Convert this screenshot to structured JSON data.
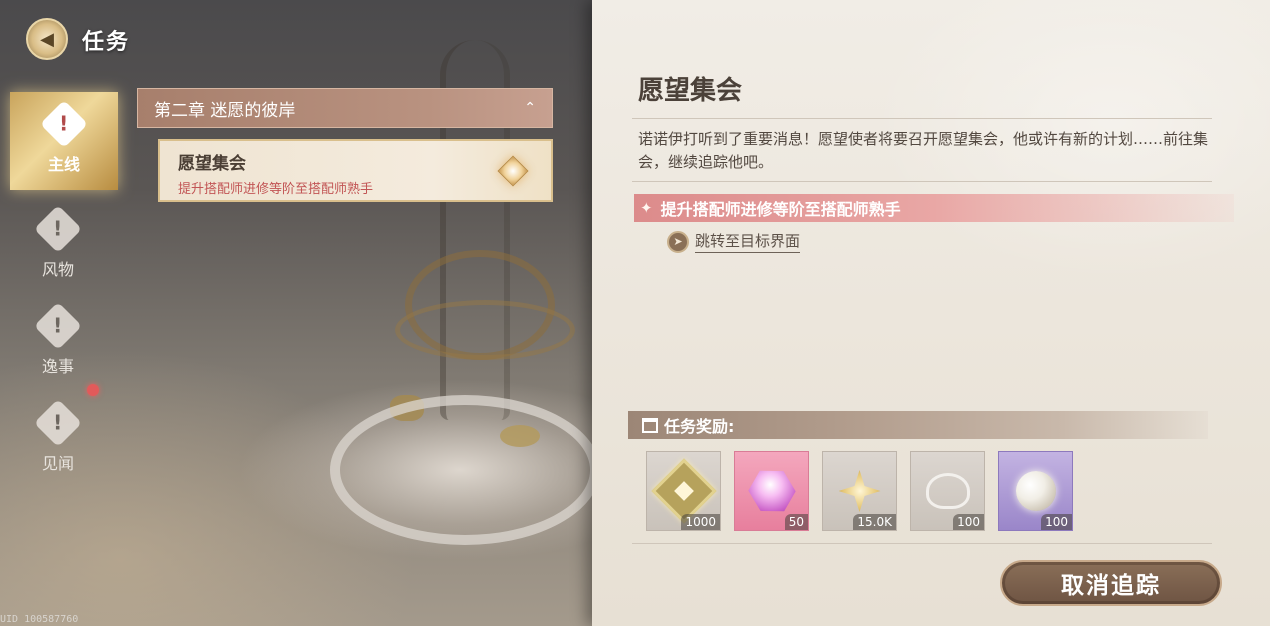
{
  "header": {
    "title": "任务",
    "back_icon": "back-arrow-icon"
  },
  "sidebar": {
    "items": [
      {
        "label": "主线",
        "icon": "alert-diamond-icon",
        "active": true
      },
      {
        "label": "风物",
        "icon": "alert-diamond-icon",
        "active": false
      },
      {
        "label": "逸事",
        "icon": "alert-diamond-icon",
        "active": false
      },
      {
        "label": "见闻",
        "icon": "alert-diamond-icon",
        "active": false
      }
    ]
  },
  "quest_list": {
    "chapter": "第二章 迷愿的彼岸",
    "items": [
      {
        "title": "愿望集会",
        "subtitle": "提升搭配师进修等阶至搭配师熟手"
      }
    ]
  },
  "detail": {
    "title": "愿望集会",
    "description": "诺诺伊打听到了重要消息！愿望使者将要召开愿望集会，他或许有新的计划……前往集会，继续追踪他吧。",
    "objective": "提升搭配师进修等阶至搭配师熟手",
    "jump_link": "跳转至目标界面",
    "rewards_label": "任务奖励:",
    "rewards": [
      {
        "icon": "badge-icon",
        "qty": "1000"
      },
      {
        "icon": "crystal-icon",
        "qty": "50"
      },
      {
        "icon": "star-gem-icon",
        "qty": "15.0K"
      },
      {
        "icon": "ribbon-icon",
        "qty": "100"
      },
      {
        "icon": "pearl-icon",
        "qty": "100"
      }
    ],
    "cancel_button": "取消追踪"
  },
  "uid": "UID 100587760",
  "colors": {
    "accent_gold": "#e9cf8f",
    "objective_red": "#dc8b8b",
    "button_brown": "#7a5f4c"
  }
}
